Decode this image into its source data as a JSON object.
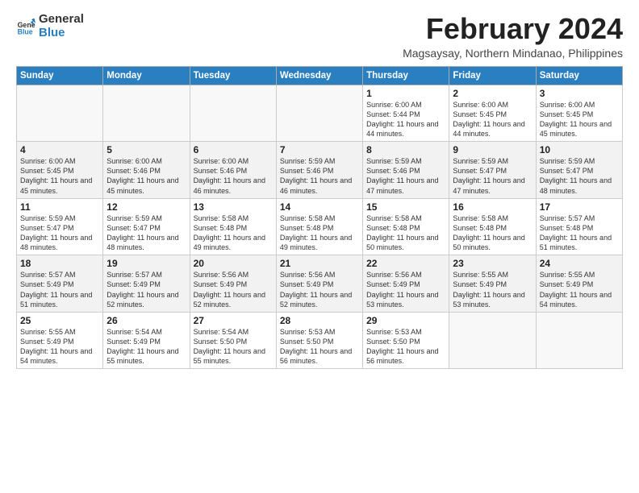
{
  "logo": {
    "line1": "General",
    "line2": "Blue"
  },
  "title": "February 2024",
  "location": "Magsaysay, Northern Mindanao, Philippines",
  "weekdays": [
    "Sunday",
    "Monday",
    "Tuesday",
    "Wednesday",
    "Thursday",
    "Friday",
    "Saturday"
  ],
  "weeks": [
    [
      {
        "day": "",
        "sunrise": "",
        "sunset": "",
        "daylight": "",
        "empty": true
      },
      {
        "day": "",
        "sunrise": "",
        "sunset": "",
        "daylight": "",
        "empty": true
      },
      {
        "day": "",
        "sunrise": "",
        "sunset": "",
        "daylight": "",
        "empty": true
      },
      {
        "day": "",
        "sunrise": "",
        "sunset": "",
        "daylight": "",
        "empty": true
      },
      {
        "day": "1",
        "sunrise": "Sunrise: 6:00 AM",
        "sunset": "Sunset: 5:44 PM",
        "daylight": "Daylight: 11 hours and 44 minutes.",
        "empty": false
      },
      {
        "day": "2",
        "sunrise": "Sunrise: 6:00 AM",
        "sunset": "Sunset: 5:45 PM",
        "daylight": "Daylight: 11 hours and 44 minutes.",
        "empty": false
      },
      {
        "day": "3",
        "sunrise": "Sunrise: 6:00 AM",
        "sunset": "Sunset: 5:45 PM",
        "daylight": "Daylight: 11 hours and 45 minutes.",
        "empty": false
      }
    ],
    [
      {
        "day": "4",
        "sunrise": "Sunrise: 6:00 AM",
        "sunset": "Sunset: 5:45 PM",
        "daylight": "Daylight: 11 hours and 45 minutes.",
        "empty": false
      },
      {
        "day": "5",
        "sunrise": "Sunrise: 6:00 AM",
        "sunset": "Sunset: 5:46 PM",
        "daylight": "Daylight: 11 hours and 45 minutes.",
        "empty": false
      },
      {
        "day": "6",
        "sunrise": "Sunrise: 6:00 AM",
        "sunset": "Sunset: 5:46 PM",
        "daylight": "Daylight: 11 hours and 46 minutes.",
        "empty": false
      },
      {
        "day": "7",
        "sunrise": "Sunrise: 5:59 AM",
        "sunset": "Sunset: 5:46 PM",
        "daylight": "Daylight: 11 hours and 46 minutes.",
        "empty": false
      },
      {
        "day": "8",
        "sunrise": "Sunrise: 5:59 AM",
        "sunset": "Sunset: 5:46 PM",
        "daylight": "Daylight: 11 hours and 47 minutes.",
        "empty": false
      },
      {
        "day": "9",
        "sunrise": "Sunrise: 5:59 AM",
        "sunset": "Sunset: 5:47 PM",
        "daylight": "Daylight: 11 hours and 47 minutes.",
        "empty": false
      },
      {
        "day": "10",
        "sunrise": "Sunrise: 5:59 AM",
        "sunset": "Sunset: 5:47 PM",
        "daylight": "Daylight: 11 hours and 48 minutes.",
        "empty": false
      }
    ],
    [
      {
        "day": "11",
        "sunrise": "Sunrise: 5:59 AM",
        "sunset": "Sunset: 5:47 PM",
        "daylight": "Daylight: 11 hours and 48 minutes.",
        "empty": false
      },
      {
        "day": "12",
        "sunrise": "Sunrise: 5:59 AM",
        "sunset": "Sunset: 5:47 PM",
        "daylight": "Daylight: 11 hours and 48 minutes.",
        "empty": false
      },
      {
        "day": "13",
        "sunrise": "Sunrise: 5:58 AM",
        "sunset": "Sunset: 5:48 PM",
        "daylight": "Daylight: 11 hours and 49 minutes.",
        "empty": false
      },
      {
        "day": "14",
        "sunrise": "Sunrise: 5:58 AM",
        "sunset": "Sunset: 5:48 PM",
        "daylight": "Daylight: 11 hours and 49 minutes.",
        "empty": false
      },
      {
        "day": "15",
        "sunrise": "Sunrise: 5:58 AM",
        "sunset": "Sunset: 5:48 PM",
        "daylight": "Daylight: 11 hours and 50 minutes.",
        "empty": false
      },
      {
        "day": "16",
        "sunrise": "Sunrise: 5:58 AM",
        "sunset": "Sunset: 5:48 PM",
        "daylight": "Daylight: 11 hours and 50 minutes.",
        "empty": false
      },
      {
        "day": "17",
        "sunrise": "Sunrise: 5:57 AM",
        "sunset": "Sunset: 5:48 PM",
        "daylight": "Daylight: 11 hours and 51 minutes.",
        "empty": false
      }
    ],
    [
      {
        "day": "18",
        "sunrise": "Sunrise: 5:57 AM",
        "sunset": "Sunset: 5:49 PM",
        "daylight": "Daylight: 11 hours and 51 minutes.",
        "empty": false
      },
      {
        "day": "19",
        "sunrise": "Sunrise: 5:57 AM",
        "sunset": "Sunset: 5:49 PM",
        "daylight": "Daylight: 11 hours and 52 minutes.",
        "empty": false
      },
      {
        "day": "20",
        "sunrise": "Sunrise: 5:56 AM",
        "sunset": "Sunset: 5:49 PM",
        "daylight": "Daylight: 11 hours and 52 minutes.",
        "empty": false
      },
      {
        "day": "21",
        "sunrise": "Sunrise: 5:56 AM",
        "sunset": "Sunset: 5:49 PM",
        "daylight": "Daylight: 11 hours and 52 minutes.",
        "empty": false
      },
      {
        "day": "22",
        "sunrise": "Sunrise: 5:56 AM",
        "sunset": "Sunset: 5:49 PM",
        "daylight": "Daylight: 11 hours and 53 minutes.",
        "empty": false
      },
      {
        "day": "23",
        "sunrise": "Sunrise: 5:55 AM",
        "sunset": "Sunset: 5:49 PM",
        "daylight": "Daylight: 11 hours and 53 minutes.",
        "empty": false
      },
      {
        "day": "24",
        "sunrise": "Sunrise: 5:55 AM",
        "sunset": "Sunset: 5:49 PM",
        "daylight": "Daylight: 11 hours and 54 minutes.",
        "empty": false
      }
    ],
    [
      {
        "day": "25",
        "sunrise": "Sunrise: 5:55 AM",
        "sunset": "Sunset: 5:49 PM",
        "daylight": "Daylight: 11 hours and 54 minutes.",
        "empty": false
      },
      {
        "day": "26",
        "sunrise": "Sunrise: 5:54 AM",
        "sunset": "Sunset: 5:49 PM",
        "daylight": "Daylight: 11 hours and 55 minutes.",
        "empty": false
      },
      {
        "day": "27",
        "sunrise": "Sunrise: 5:54 AM",
        "sunset": "Sunset: 5:50 PM",
        "daylight": "Daylight: 11 hours and 55 minutes.",
        "empty": false
      },
      {
        "day": "28",
        "sunrise": "Sunrise: 5:53 AM",
        "sunset": "Sunset: 5:50 PM",
        "daylight": "Daylight: 11 hours and 56 minutes.",
        "empty": false
      },
      {
        "day": "29",
        "sunrise": "Sunrise: 5:53 AM",
        "sunset": "Sunset: 5:50 PM",
        "daylight": "Daylight: 11 hours and 56 minutes.",
        "empty": false
      },
      {
        "day": "",
        "sunrise": "",
        "sunset": "",
        "daylight": "",
        "empty": true
      },
      {
        "day": "",
        "sunrise": "",
        "sunset": "",
        "daylight": "",
        "empty": true
      }
    ]
  ]
}
